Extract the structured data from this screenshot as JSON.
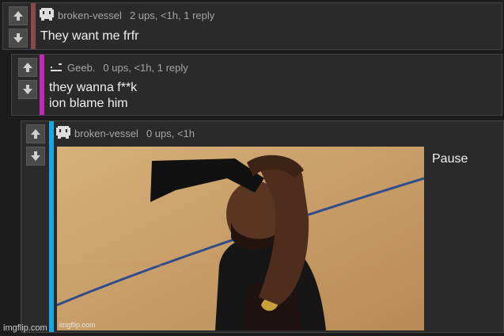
{
  "comments": [
    {
      "username": "broken-vessel",
      "meta": "2 ups, <1h, 1 reply",
      "lines": [
        "They want me frfr"
      ],
      "bar_color": "#8a4a4a"
    },
    {
      "username": "Geeb.",
      "meta": "0 ups, <1h, 1 reply",
      "lines": [
        "they wanna f**k",
        "ion blame him"
      ],
      "bar_color": "#c428b8"
    },
    {
      "username": "broken-vessel",
      "meta": "0 ups, <1h",
      "lines": [
        "Pause"
      ],
      "bar_color": "#1aa6e0"
    }
  ],
  "icons": {
    "upvote": "arrow-up-icon",
    "downvote": "arrow-down-icon",
    "avatar": "pixel-avatar-icon"
  },
  "watermarks": {
    "page": "imgflip.com",
    "image": "imgflip.com"
  }
}
